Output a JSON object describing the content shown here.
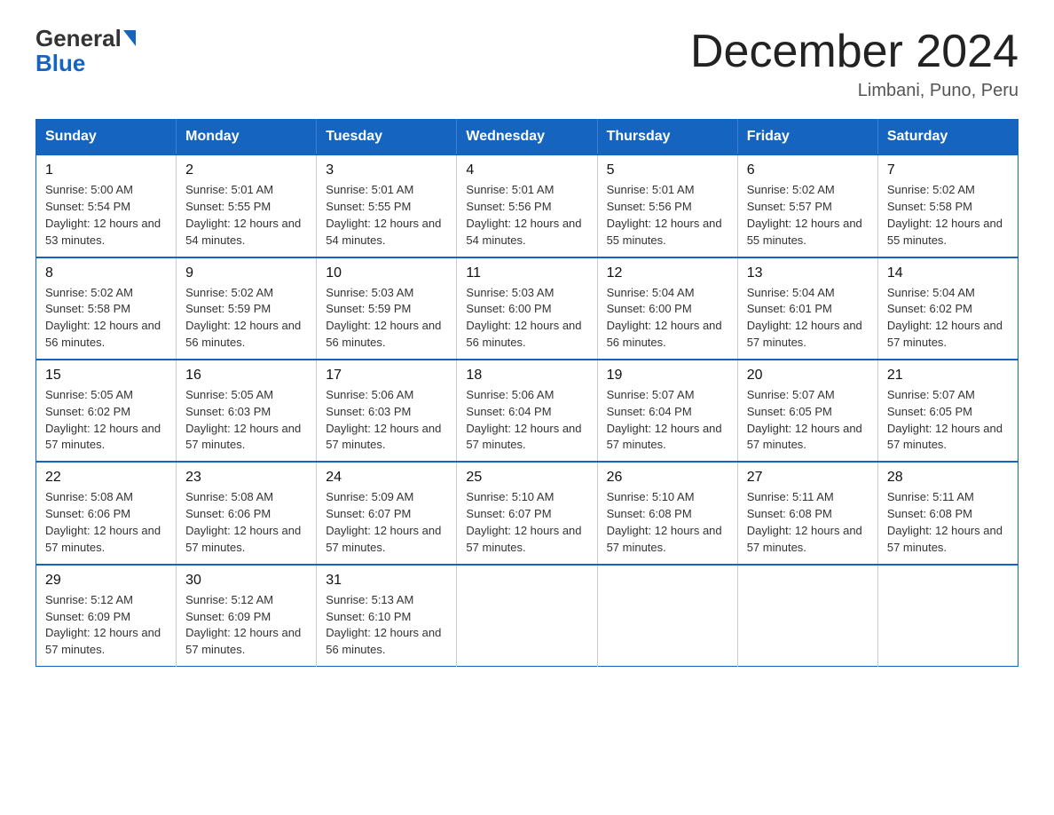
{
  "logo": {
    "general": "General",
    "blue": "Blue"
  },
  "title": "December 2024",
  "subtitle": "Limbani, Puno, Peru",
  "header": {
    "days": [
      "Sunday",
      "Monday",
      "Tuesday",
      "Wednesday",
      "Thursday",
      "Friday",
      "Saturday"
    ]
  },
  "weeks": [
    [
      {
        "day": "1",
        "sunrise": "Sunrise: 5:00 AM",
        "sunset": "Sunset: 5:54 PM",
        "daylight": "Daylight: 12 hours and 53 minutes."
      },
      {
        "day": "2",
        "sunrise": "Sunrise: 5:01 AM",
        "sunset": "Sunset: 5:55 PM",
        "daylight": "Daylight: 12 hours and 54 minutes."
      },
      {
        "day": "3",
        "sunrise": "Sunrise: 5:01 AM",
        "sunset": "Sunset: 5:55 PM",
        "daylight": "Daylight: 12 hours and 54 minutes."
      },
      {
        "day": "4",
        "sunrise": "Sunrise: 5:01 AM",
        "sunset": "Sunset: 5:56 PM",
        "daylight": "Daylight: 12 hours and 54 minutes."
      },
      {
        "day": "5",
        "sunrise": "Sunrise: 5:01 AM",
        "sunset": "Sunset: 5:56 PM",
        "daylight": "Daylight: 12 hours and 55 minutes."
      },
      {
        "day": "6",
        "sunrise": "Sunrise: 5:02 AM",
        "sunset": "Sunset: 5:57 PM",
        "daylight": "Daylight: 12 hours and 55 minutes."
      },
      {
        "day": "7",
        "sunrise": "Sunrise: 5:02 AM",
        "sunset": "Sunset: 5:58 PM",
        "daylight": "Daylight: 12 hours and 55 minutes."
      }
    ],
    [
      {
        "day": "8",
        "sunrise": "Sunrise: 5:02 AM",
        "sunset": "Sunset: 5:58 PM",
        "daylight": "Daylight: 12 hours and 56 minutes."
      },
      {
        "day": "9",
        "sunrise": "Sunrise: 5:02 AM",
        "sunset": "Sunset: 5:59 PM",
        "daylight": "Daylight: 12 hours and 56 minutes."
      },
      {
        "day": "10",
        "sunrise": "Sunrise: 5:03 AM",
        "sunset": "Sunset: 5:59 PM",
        "daylight": "Daylight: 12 hours and 56 minutes."
      },
      {
        "day": "11",
        "sunrise": "Sunrise: 5:03 AM",
        "sunset": "Sunset: 6:00 PM",
        "daylight": "Daylight: 12 hours and 56 minutes."
      },
      {
        "day": "12",
        "sunrise": "Sunrise: 5:04 AM",
        "sunset": "Sunset: 6:00 PM",
        "daylight": "Daylight: 12 hours and 56 minutes."
      },
      {
        "day": "13",
        "sunrise": "Sunrise: 5:04 AM",
        "sunset": "Sunset: 6:01 PM",
        "daylight": "Daylight: 12 hours and 57 minutes."
      },
      {
        "day": "14",
        "sunrise": "Sunrise: 5:04 AM",
        "sunset": "Sunset: 6:02 PM",
        "daylight": "Daylight: 12 hours and 57 minutes."
      }
    ],
    [
      {
        "day": "15",
        "sunrise": "Sunrise: 5:05 AM",
        "sunset": "Sunset: 6:02 PM",
        "daylight": "Daylight: 12 hours and 57 minutes."
      },
      {
        "day": "16",
        "sunrise": "Sunrise: 5:05 AM",
        "sunset": "Sunset: 6:03 PM",
        "daylight": "Daylight: 12 hours and 57 minutes."
      },
      {
        "day": "17",
        "sunrise": "Sunrise: 5:06 AM",
        "sunset": "Sunset: 6:03 PM",
        "daylight": "Daylight: 12 hours and 57 minutes."
      },
      {
        "day": "18",
        "sunrise": "Sunrise: 5:06 AM",
        "sunset": "Sunset: 6:04 PM",
        "daylight": "Daylight: 12 hours and 57 minutes."
      },
      {
        "day": "19",
        "sunrise": "Sunrise: 5:07 AM",
        "sunset": "Sunset: 6:04 PM",
        "daylight": "Daylight: 12 hours and 57 minutes."
      },
      {
        "day": "20",
        "sunrise": "Sunrise: 5:07 AM",
        "sunset": "Sunset: 6:05 PM",
        "daylight": "Daylight: 12 hours and 57 minutes."
      },
      {
        "day": "21",
        "sunrise": "Sunrise: 5:07 AM",
        "sunset": "Sunset: 6:05 PM",
        "daylight": "Daylight: 12 hours and 57 minutes."
      }
    ],
    [
      {
        "day": "22",
        "sunrise": "Sunrise: 5:08 AM",
        "sunset": "Sunset: 6:06 PM",
        "daylight": "Daylight: 12 hours and 57 minutes."
      },
      {
        "day": "23",
        "sunrise": "Sunrise: 5:08 AM",
        "sunset": "Sunset: 6:06 PM",
        "daylight": "Daylight: 12 hours and 57 minutes."
      },
      {
        "day": "24",
        "sunrise": "Sunrise: 5:09 AM",
        "sunset": "Sunset: 6:07 PM",
        "daylight": "Daylight: 12 hours and 57 minutes."
      },
      {
        "day": "25",
        "sunrise": "Sunrise: 5:10 AM",
        "sunset": "Sunset: 6:07 PM",
        "daylight": "Daylight: 12 hours and 57 minutes."
      },
      {
        "day": "26",
        "sunrise": "Sunrise: 5:10 AM",
        "sunset": "Sunset: 6:08 PM",
        "daylight": "Daylight: 12 hours and 57 minutes."
      },
      {
        "day": "27",
        "sunrise": "Sunrise: 5:11 AM",
        "sunset": "Sunset: 6:08 PM",
        "daylight": "Daylight: 12 hours and 57 minutes."
      },
      {
        "day": "28",
        "sunrise": "Sunrise: 5:11 AM",
        "sunset": "Sunset: 6:08 PM",
        "daylight": "Daylight: 12 hours and 57 minutes."
      }
    ],
    [
      {
        "day": "29",
        "sunrise": "Sunrise: 5:12 AM",
        "sunset": "Sunset: 6:09 PM",
        "daylight": "Daylight: 12 hours and 57 minutes."
      },
      {
        "day": "30",
        "sunrise": "Sunrise: 5:12 AM",
        "sunset": "Sunset: 6:09 PM",
        "daylight": "Daylight: 12 hours and 57 minutes."
      },
      {
        "day": "31",
        "sunrise": "Sunrise: 5:13 AM",
        "sunset": "Sunset: 6:10 PM",
        "daylight": "Daylight: 12 hours and 56 minutes."
      },
      {
        "day": "",
        "sunrise": "",
        "sunset": "",
        "daylight": ""
      },
      {
        "day": "",
        "sunrise": "",
        "sunset": "",
        "daylight": ""
      },
      {
        "day": "",
        "sunrise": "",
        "sunset": "",
        "daylight": ""
      },
      {
        "day": "",
        "sunrise": "",
        "sunset": "",
        "daylight": ""
      }
    ]
  ]
}
